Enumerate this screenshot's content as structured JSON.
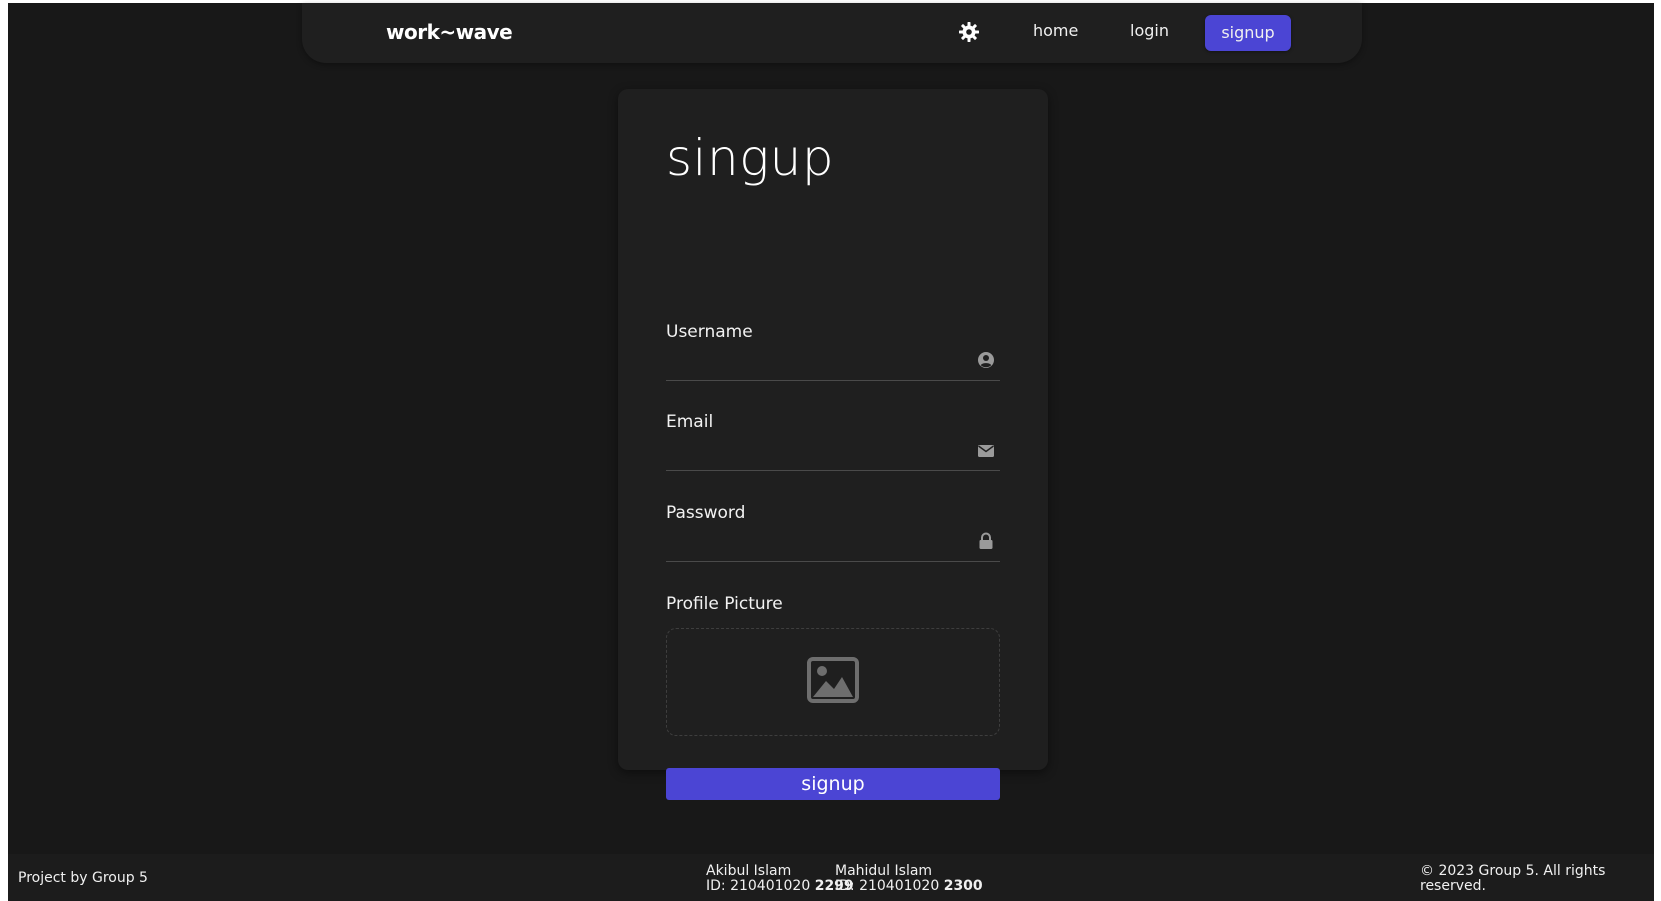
{
  "navbar": {
    "brand": "work~wave",
    "theme_icon": "gear-icon",
    "links": {
      "home": "home",
      "login": "login",
      "signup": "signup"
    }
  },
  "form": {
    "title": "singup",
    "username": {
      "label": "Username",
      "value": "",
      "icon": "user-circle-icon"
    },
    "email": {
      "label": "Email",
      "value": "",
      "icon": "envelope-icon"
    },
    "password": {
      "label": "Password",
      "value": "",
      "icon": "lock-icon"
    },
    "profile_picture": {
      "label": "Profile Picture",
      "icon": "image-icon"
    },
    "submit_label": "signup"
  },
  "footer": {
    "left": "Project by Group 5",
    "members": [
      {
        "name": "Akibul Islam",
        "id_prefix": "ID: 210401020 ",
        "id_suffix": "2299"
      },
      {
        "name": "Mahidul Islam",
        "id_prefix": "ID: 210401020 ",
        "id_suffix": "2300"
      }
    ],
    "copyright": "© 2023 Group 5. All rights reserved."
  },
  "colors": {
    "accent": "#4b45d4",
    "background": "#181818",
    "surface": "#1f1f1f"
  }
}
